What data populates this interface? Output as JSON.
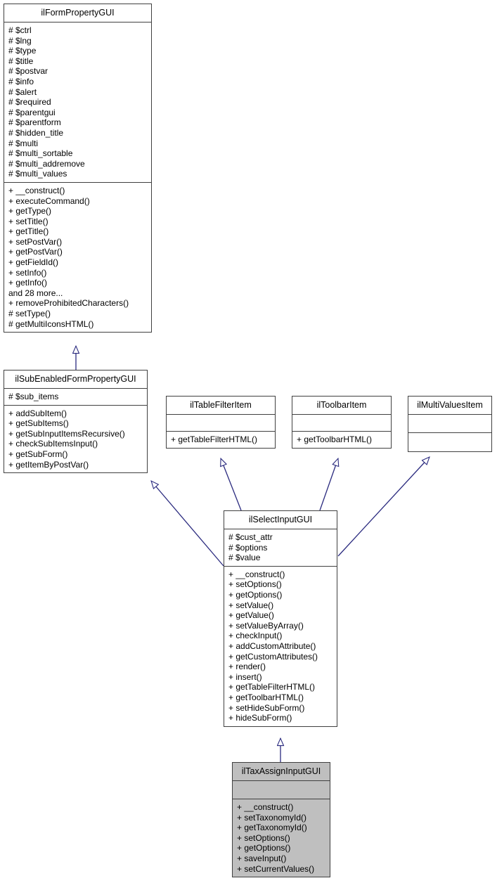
{
  "diagram": {
    "type": "uml-class-diagram",
    "title": "ilTaxAssignInputGUI inheritance diagram",
    "colors": {
      "box_border": "#404040",
      "box_fill": "#ffffff",
      "highlight_fill": "#bfbfbf",
      "connector": "#2b2b7f",
      "text": "#000000"
    },
    "relationship_label": "generalization"
  },
  "classes": {
    "ilFormPropertyGUI": {
      "name": "ilFormPropertyGUI",
      "highlighted": false,
      "attributes": [
        "# $ctrl",
        "# $lng",
        "# $type",
        "# $title",
        "# $postvar",
        "# $info",
        "# $alert",
        "# $required",
        "# $parentgui",
        "# $parentform",
        "# $hidden_title",
        "# $multi",
        "# $multi_sortable",
        "# $multi_addremove",
        "# $multi_values"
      ],
      "methods": [
        "+ __construct()",
        "+ executeCommand()",
        "+ getType()",
        "+ setTitle()",
        "+ getTitle()",
        "+ setPostVar()",
        "+ getPostVar()",
        "+ getFieldId()",
        "+ setInfo()",
        "+ getInfo()",
        "and 28 more...",
        "+ removeProhibitedCharacters()",
        "# setType()",
        "# getMultiIconsHTML()"
      ]
    },
    "ilSubEnabledFormPropertyGUI": {
      "name": "ilSubEnabledFormPropertyGUI",
      "highlighted": false,
      "attributes": [
        "# $sub_items"
      ],
      "methods": [
        "+ addSubItem()",
        "+ getSubItems()",
        "+ getSubInputItemsRecursive()",
        "+ checkSubItemsInput()",
        "+ getSubForm()",
        "+ getItemByPostVar()"
      ]
    },
    "ilTableFilterItem": {
      "name": "ilTableFilterItem",
      "highlighted": false,
      "attributes": [],
      "methods": [
        "+ getTableFilterHTML()"
      ]
    },
    "ilToolbarItem": {
      "name": "ilToolbarItem",
      "highlighted": false,
      "attributes": [],
      "methods": [
        "+ getToolbarHTML()"
      ]
    },
    "ilMultiValuesItem": {
      "name": "ilMultiValuesItem",
      "highlighted": false,
      "attributes": [],
      "methods": []
    },
    "ilSelectInputGUI": {
      "name": "ilSelectInputGUI",
      "highlighted": false,
      "attributes": [
        "# $cust_attr",
        "# $options",
        "# $value"
      ],
      "methods": [
        "+ __construct()",
        "+ setOptions()",
        "+ getOptions()",
        "+ setValue()",
        "+ getValue()",
        "+ setValueByArray()",
        "+ checkInput()",
        "+ addCustomAttribute()",
        "+ getCustomAttributes()",
        "+ render()",
        "+ insert()",
        "+ getTableFilterHTML()",
        "+ getToolbarHTML()",
        "+ setHideSubForm()",
        "+ hideSubForm()"
      ]
    },
    "ilTaxAssignInputGUI": {
      "name": "ilTaxAssignInputGUI",
      "highlighted": true,
      "attributes": [],
      "methods": [
        "+ __construct()",
        "+ setTaxonomyId()",
        "+ getTaxonomyId()",
        "+ setOptions()",
        "+ getOptions()",
        "+ saveInput()",
        "+ setCurrentValues()"
      ]
    }
  },
  "relations": [
    {
      "from": "ilSubEnabledFormPropertyGUI",
      "to": "ilFormPropertyGUI",
      "kind": "generalization"
    },
    {
      "from": "ilSelectInputGUI",
      "to": "ilSubEnabledFormPropertyGUI",
      "kind": "generalization"
    },
    {
      "from": "ilSelectInputGUI",
      "to": "ilTableFilterItem",
      "kind": "generalization"
    },
    {
      "from": "ilSelectInputGUI",
      "to": "ilToolbarItem",
      "kind": "generalization"
    },
    {
      "from": "ilSelectInputGUI",
      "to": "ilMultiValuesItem",
      "kind": "generalization"
    },
    {
      "from": "ilTaxAssignInputGUI",
      "to": "ilSelectInputGUI",
      "kind": "generalization"
    }
  ]
}
